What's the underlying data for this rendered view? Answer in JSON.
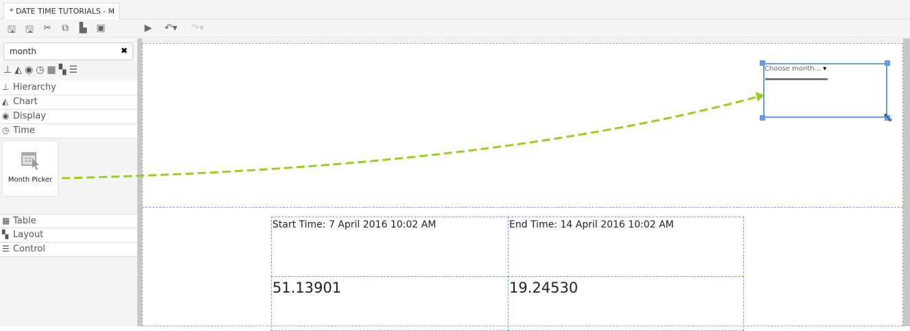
{
  "tab": {
    "title": "* DATE TIME TUTORIALS - M",
    "close": "✕"
  },
  "toolbar": {
    "icons": [
      "save-icon",
      "save-as-icon",
      "cut-icon",
      "copy-icon",
      "paste-icon",
      "preview-icon",
      "run-icon",
      "undo-icon",
      "redo-icon"
    ]
  },
  "sidebar": {
    "search": {
      "value": "month",
      "clear": "✖"
    },
    "categories": [
      {
        "label": "Hierarchy",
        "icon": "⊥"
      },
      {
        "label": "Chart",
        "icon": "◭"
      },
      {
        "label": "Display",
        "icon": "◉"
      },
      {
        "label": "Time",
        "icon": "◷"
      },
      {
        "label": "Table",
        "icon": "▦"
      },
      {
        "label": "Layout",
        "icon": "▚"
      },
      {
        "label": "Control",
        "icon": "☰"
      }
    ],
    "widget": {
      "label": "Month Picker"
    }
  },
  "canvas": {
    "picker": {
      "placeholder": "Choose month...",
      "arrow": "▾"
    },
    "table": {
      "start": "Start Time: 7 April 2016 10:02 AM",
      "end": "End Time: 14 April 2016 10:02 AM",
      "value1": "51.13901",
      "value2": "19.24530"
    }
  },
  "colors": {
    "accent": "#6a9be8",
    "arrow": "#9acd1e"
  }
}
